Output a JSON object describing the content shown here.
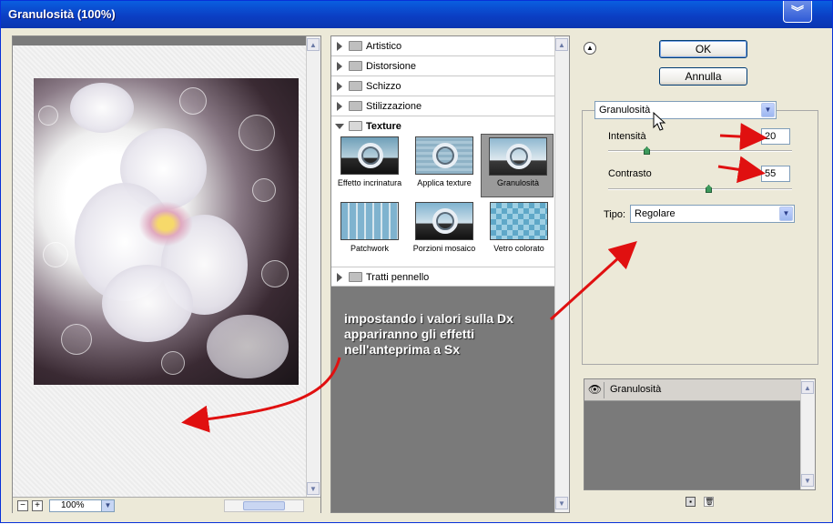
{
  "window": {
    "title": "Granulosità  (100%)"
  },
  "preview": {
    "zoom": "100%"
  },
  "filter_categories": [
    {
      "label": "Artistico",
      "expanded": false
    },
    {
      "label": "Distorsione",
      "expanded": false
    },
    {
      "label": "Schizzo",
      "expanded": false
    },
    {
      "label": "Stilizzazione",
      "expanded": false
    },
    {
      "label": "Texture",
      "expanded": true
    },
    {
      "label": "Tratti pennello",
      "expanded": false
    }
  ],
  "texture_filters": [
    {
      "label": "Effetto incrinatura",
      "selected": false
    },
    {
      "label": "Applica texture",
      "selected": false
    },
    {
      "label": "Granulosità",
      "selected": true
    },
    {
      "label": "Patchwork",
      "selected": false
    },
    {
      "label": "Porzioni mosaico",
      "selected": false
    },
    {
      "label": "Vetro colorato",
      "selected": false
    }
  ],
  "annotation": {
    "text": "impostando i valori sulla Dx appariranno gli effetti nell'anteprima a Sx"
  },
  "buttons": {
    "ok": "OK",
    "cancel": "Annulla"
  },
  "settings": {
    "filter_select": "Granulosità",
    "intensity": {
      "label": "Intensità",
      "value": "20",
      "fraction": 0.2
    },
    "contrast": {
      "label": "Contrasto",
      "value": "55",
      "fraction": 0.55
    },
    "type": {
      "label": "Tipo:",
      "value": "Regolare"
    }
  },
  "layers": {
    "items": [
      {
        "label": "Granulosità"
      }
    ]
  },
  "colors": {
    "titlebar": "#0a5fe0",
    "annotation_arrow": "#e01010",
    "panel_gray": "#7a7a7a"
  }
}
